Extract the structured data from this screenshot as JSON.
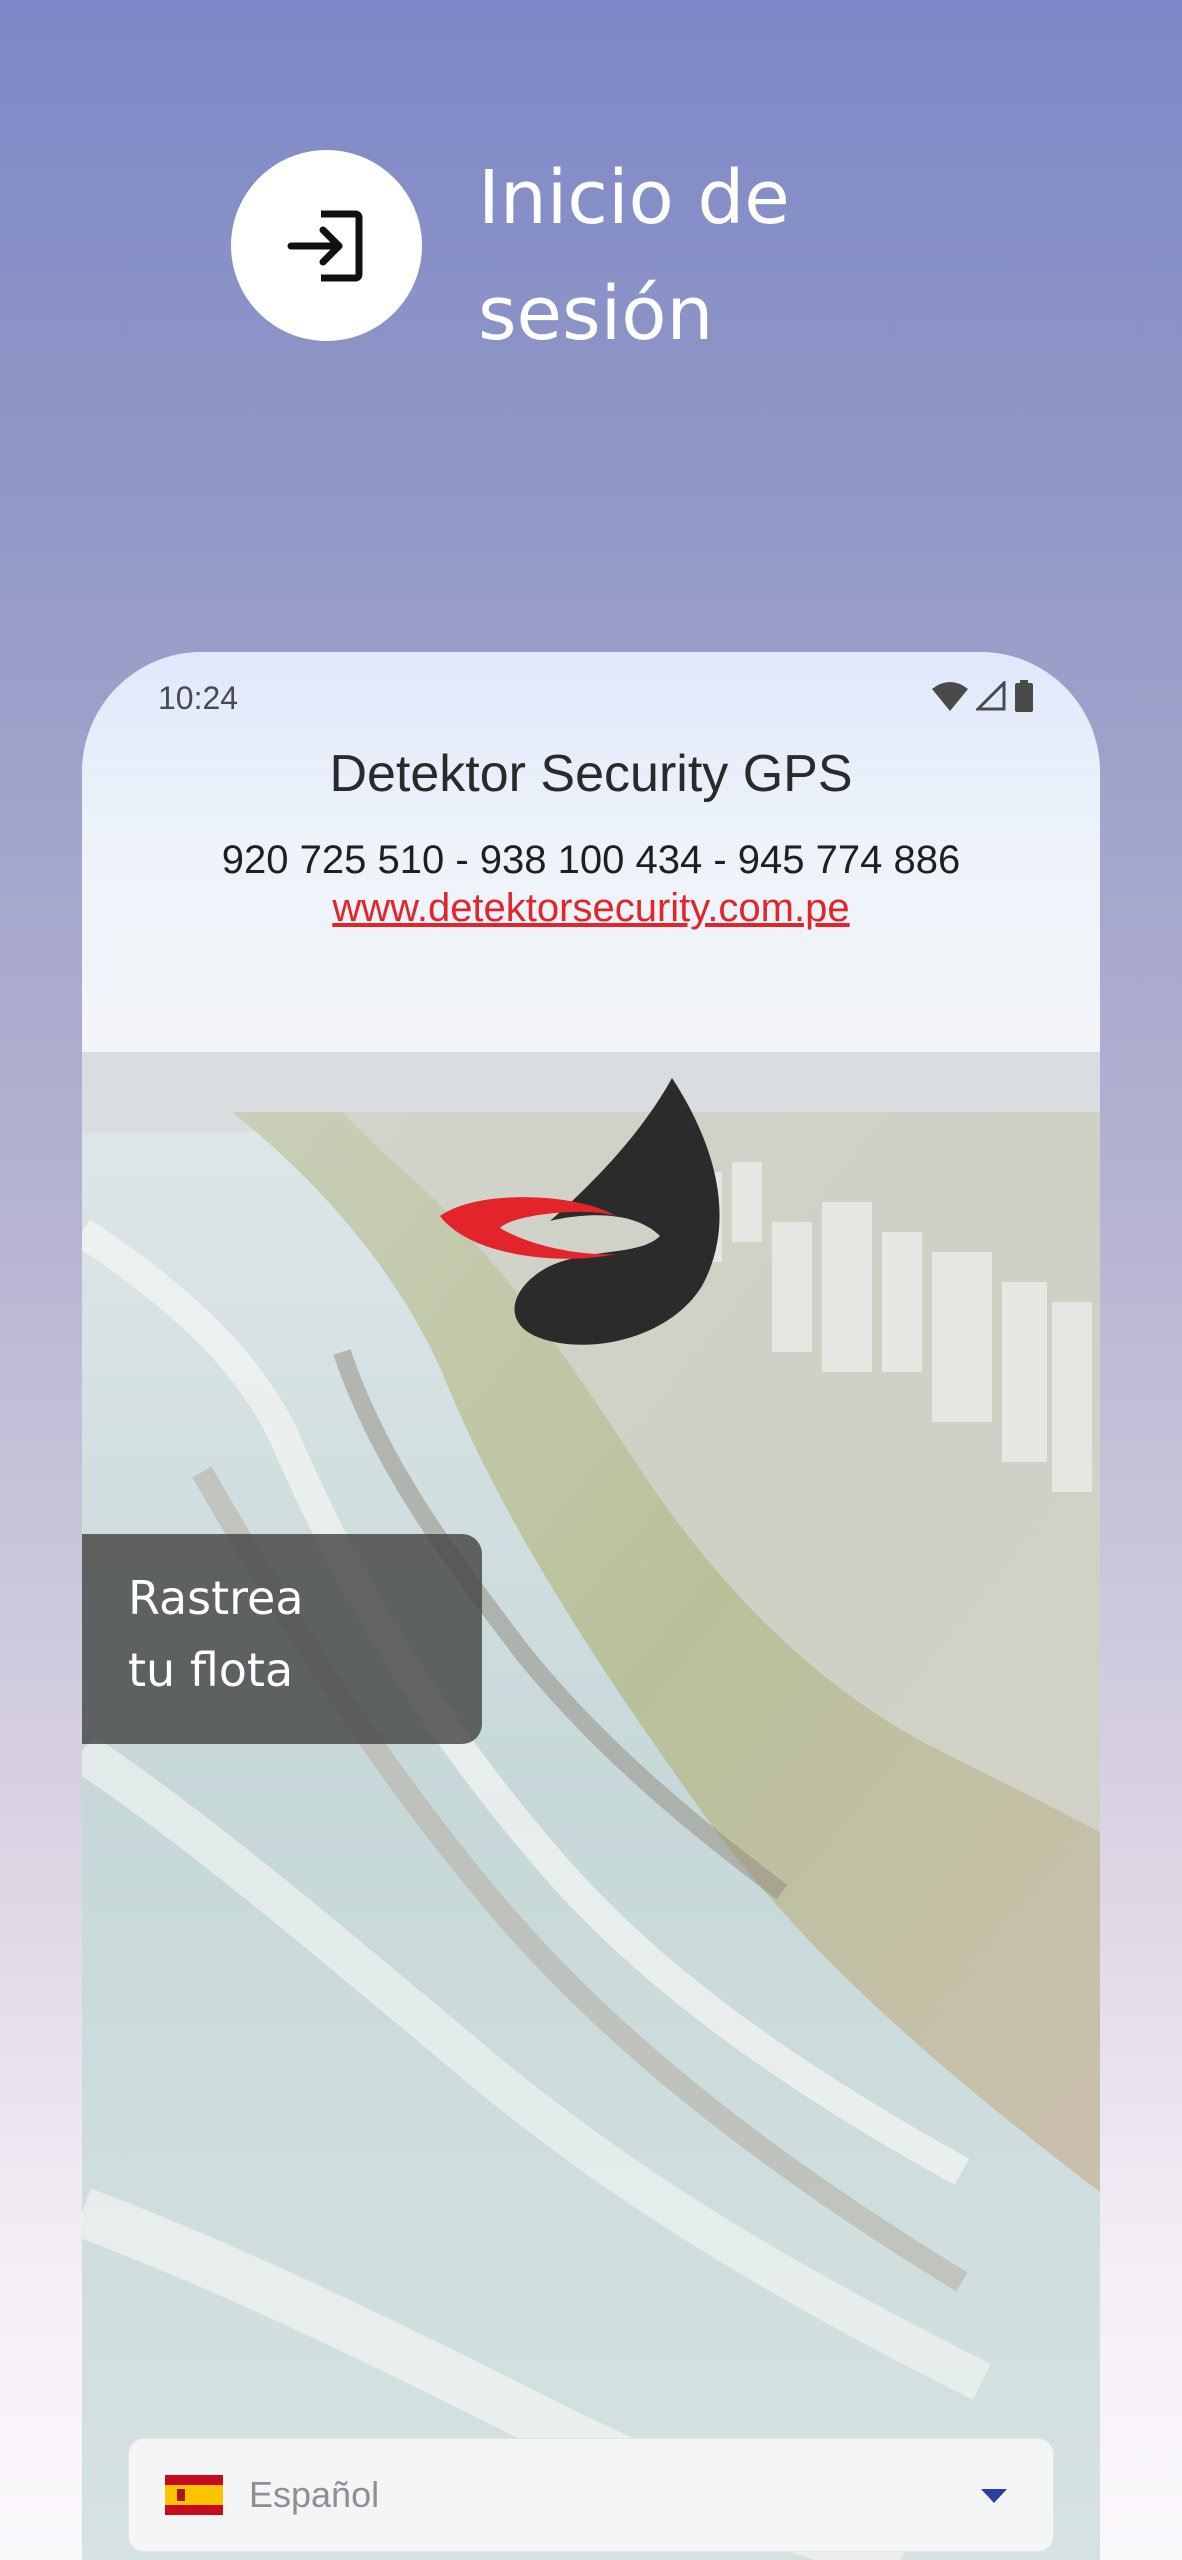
{
  "header": {
    "title": "Inicio de sesión",
    "icon": "login-icon"
  },
  "phone": {
    "status_bar": {
      "time": "10:24",
      "icons": [
        "wifi-icon",
        "signal-icon",
        "battery-icon"
      ]
    },
    "app_title": "Detektor Security GPS",
    "phones": "920 725 510 - 938 100 434 - 945 774 886",
    "website": "www.detektorsecurity.com.pe",
    "tagline_line1": "Rastrea",
    "tagline_line2": "tu flota",
    "language": {
      "selected": "Español",
      "flag": "spain-flag-icon"
    },
    "colors": {
      "link": "#e3242b",
      "logo_red": "#e3242b",
      "logo_dark": "#2b2b2b"
    }
  }
}
